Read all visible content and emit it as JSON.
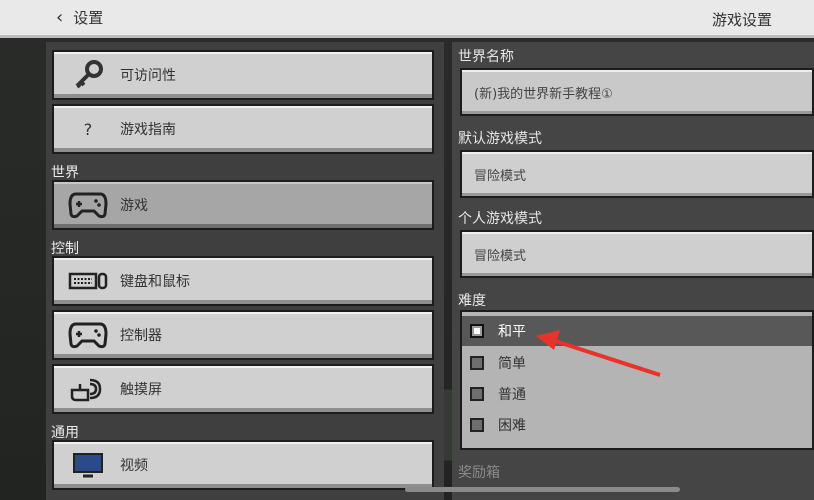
{
  "topbar": {
    "back_label": "设置",
    "title": "游戏设置"
  },
  "left": {
    "items_top": [
      {
        "label": "可访问性",
        "icon": "key-icon"
      },
      {
        "label": "游戏指南",
        "icon": "question-icon",
        "glyph": "?"
      }
    ],
    "sections": [
      {
        "title": "世界",
        "items": [
          {
            "label": "游戏",
            "icon": "gamepad-icon",
            "selected": true
          }
        ]
      },
      {
        "title": "控制",
        "items": [
          {
            "label": "键盘和鼠标",
            "icon": "keyboard-mouse-icon"
          },
          {
            "label": "控制器",
            "icon": "gamepad-icon"
          },
          {
            "label": "触摸屏",
            "icon": "touch-icon"
          }
        ]
      },
      {
        "title": "通用",
        "items": [
          {
            "label": "视频",
            "icon": "monitor-icon"
          }
        ]
      }
    ]
  },
  "right": {
    "world_name_label": "世界名称",
    "world_name_value": "(新)我的世界新手教程①",
    "default_mode_label": "默认游戏模式",
    "default_mode_value": "冒险模式",
    "personal_mode_label": "个人游戏模式",
    "personal_mode_value": "冒险模式",
    "difficulty_label": "难度",
    "difficulty_options": [
      "和平",
      "简单",
      "普通",
      "困难"
    ],
    "difficulty_selected": "和平",
    "next_label": "奖励箱"
  },
  "colors": {
    "annotation_arrow": "#e8322a"
  }
}
